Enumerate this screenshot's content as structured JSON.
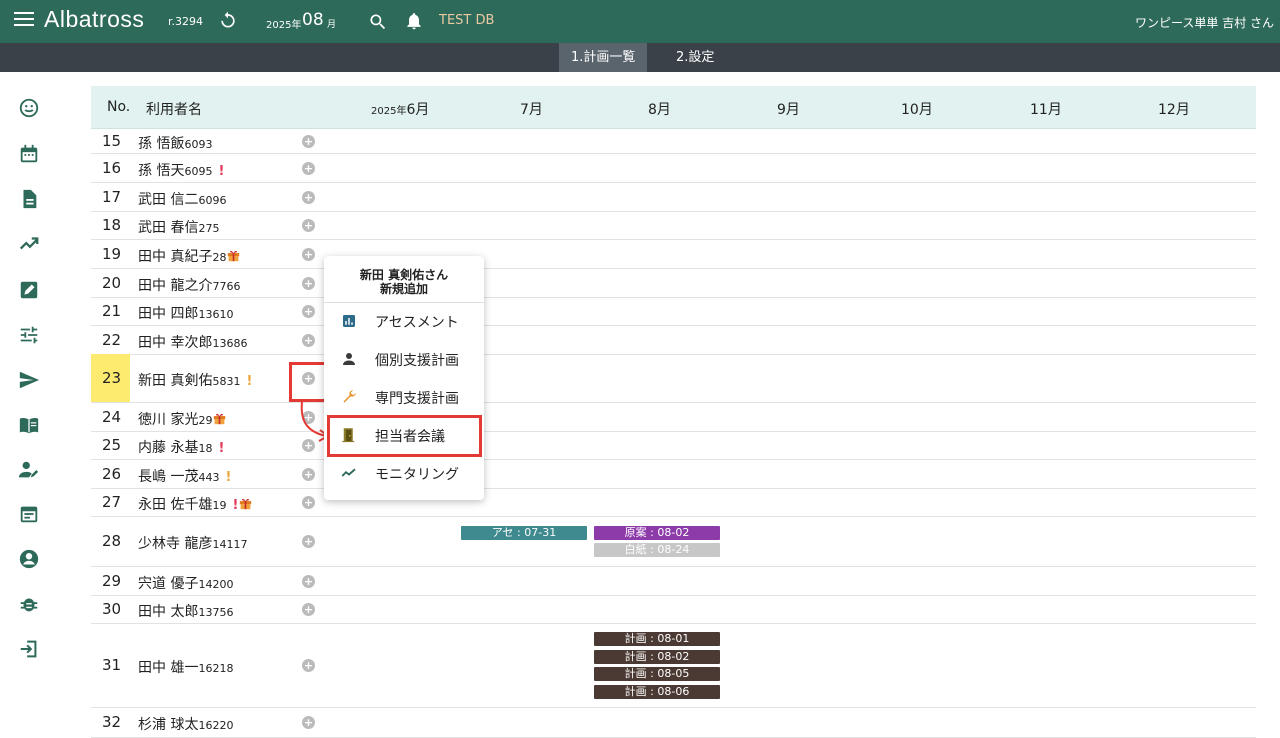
{
  "header": {
    "brand": "Albatross",
    "revision": "r.3294",
    "year": "2025年",
    "month": "08",
    "month_unit": "月",
    "db": "TEST DB",
    "user": "ワンピース単単 吉村 さん"
  },
  "subtabs": [
    "1.計画一覧",
    "2.設定"
  ],
  "sidebar_icons": [
    "smiley-icon",
    "calendar-icon",
    "document-icon",
    "trending-up-icon",
    "edit-icon",
    "tune-icon",
    "send-icon",
    "book-icon",
    "user-edit-icon",
    "event-icon",
    "account-circle-icon",
    "bug-icon",
    "logout-icon"
  ],
  "table": {
    "col_no": "No.",
    "col_name": "利用者名",
    "col_first_month_year": "2025年",
    "col_first_month": "6月",
    "months": [
      "7月",
      "8月",
      "9月",
      "10月",
      "11月",
      "12月"
    ]
  },
  "rows": [
    {
      "no": "15",
      "name": "孫 悟飯",
      "id": "6093"
    },
    {
      "no": "16",
      "name": "孫 悟天",
      "id": "6095",
      "flag": "red"
    },
    {
      "no": "17",
      "name": "武田 信二",
      "id": "6096"
    },
    {
      "no": "18",
      "name": "武田 春信",
      "id": "275"
    },
    {
      "no": "19",
      "name": "田中 真紀子",
      "id": "28",
      "gift": true
    },
    {
      "no": "20",
      "name": "田中 龍之介",
      "id": "7766"
    },
    {
      "no": "21",
      "name": "田中 四郎",
      "id": "13610"
    },
    {
      "no": "22",
      "name": "田中 幸次郎",
      "id": "13686"
    },
    {
      "no": "23",
      "name": "新田 真剣佑",
      "id": "5831",
      "flag": "orange",
      "highlight": true
    },
    {
      "no": "24",
      "name": "徳川 家光",
      "id": "29",
      "gift": true
    },
    {
      "no": "25",
      "name": "内藤 永基",
      "id": "18",
      "flag": "red"
    },
    {
      "no": "26",
      "name": "長嶋 一茂",
      "id": "443",
      "flag": "orange"
    },
    {
      "no": "27",
      "name": "永田 佐千雄",
      "id": "19",
      "flag": "red",
      "gift": true
    },
    {
      "no": "28",
      "name": "少林寺 龍彦",
      "id": "14117"
    },
    {
      "no": "29",
      "name": "宍道 優子",
      "id": "14200"
    },
    {
      "no": "30",
      "name": "田中 太郎",
      "id": "13756"
    },
    {
      "no": "31",
      "name": "田中 雄一",
      "id": "16218"
    },
    {
      "no": "32",
      "name": "杉浦 球太",
      "id": "16220"
    }
  ],
  "plus_label": "+",
  "flag_mark": "!",
  "tags": {
    "row28_assess": "アセ : 07-31",
    "row28_draft": "原案 : 08-02",
    "row28_blank": "白紙 : 08-24",
    "row31_plan1": "計画 : 08-01",
    "row31_plan2": "計画 : 08-02",
    "row31_plan3": "計画 : 08-05",
    "row31_plan4": "計画 : 08-06"
  },
  "popup": {
    "title_line1": "新田 真剣佑さん",
    "title_line2": "新規追加",
    "items": [
      "アセスメント",
      "個別支援計画",
      "専門支援計画",
      "担当者会議",
      "モニタリング"
    ]
  },
  "colors": {
    "primary": "#2e6a5a",
    "subbar": "#3a4148",
    "head_bg": "#e1f2f1",
    "highlight": "#fdeb70",
    "alert_red": "#e53935"
  }
}
